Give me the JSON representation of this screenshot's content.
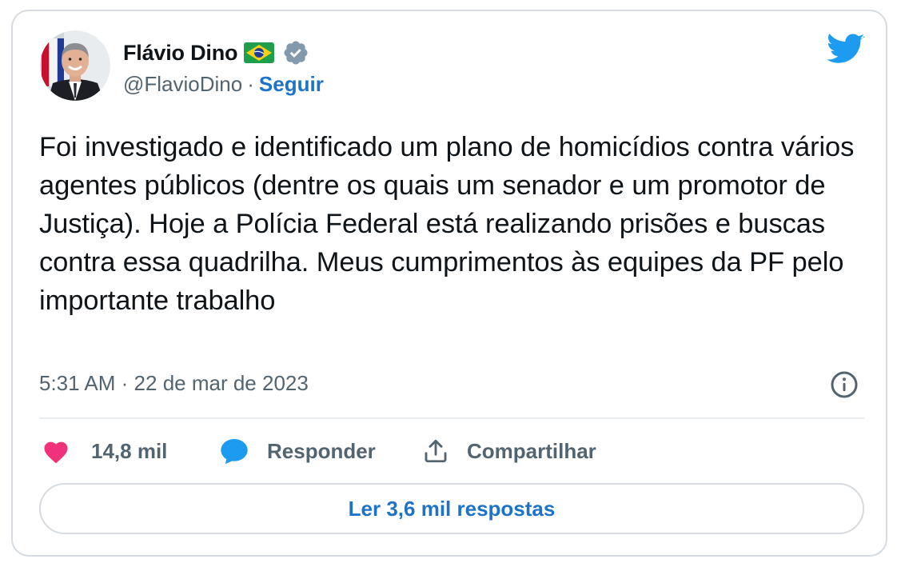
{
  "author": {
    "display_name": "Flávio Dino",
    "handle": "@FlavioDino",
    "separator": "·",
    "follow_label": "Seguir",
    "verified": true,
    "flag_icon": "brazil-flag-icon"
  },
  "tweet": {
    "text": "Foi investigado e identificado um plano de homicídios contra vários agentes públicos (dentre os quais um senador e um promotor de Justiça). Hoje a Polícia Federal está realizando prisões e buscas contra essa quadrilha. Meus cumprimentos às equipes da PF pelo importante trabalho",
    "time": "5:31 AM",
    "date": "22 de mar de 2023",
    "meta_separator": "·"
  },
  "actions": {
    "likes_count": "14,8 mil",
    "reply_label": "Responder",
    "share_label": "Compartilhar"
  },
  "replies": {
    "read_label": "Ler 3,6 mil respostas"
  },
  "colors": {
    "accent": "#1d73c9",
    "twitter_blue": "#1d9bf0",
    "like_pink": "#f0327a",
    "muted_text": "#536471",
    "border": "#d5dbe0"
  }
}
